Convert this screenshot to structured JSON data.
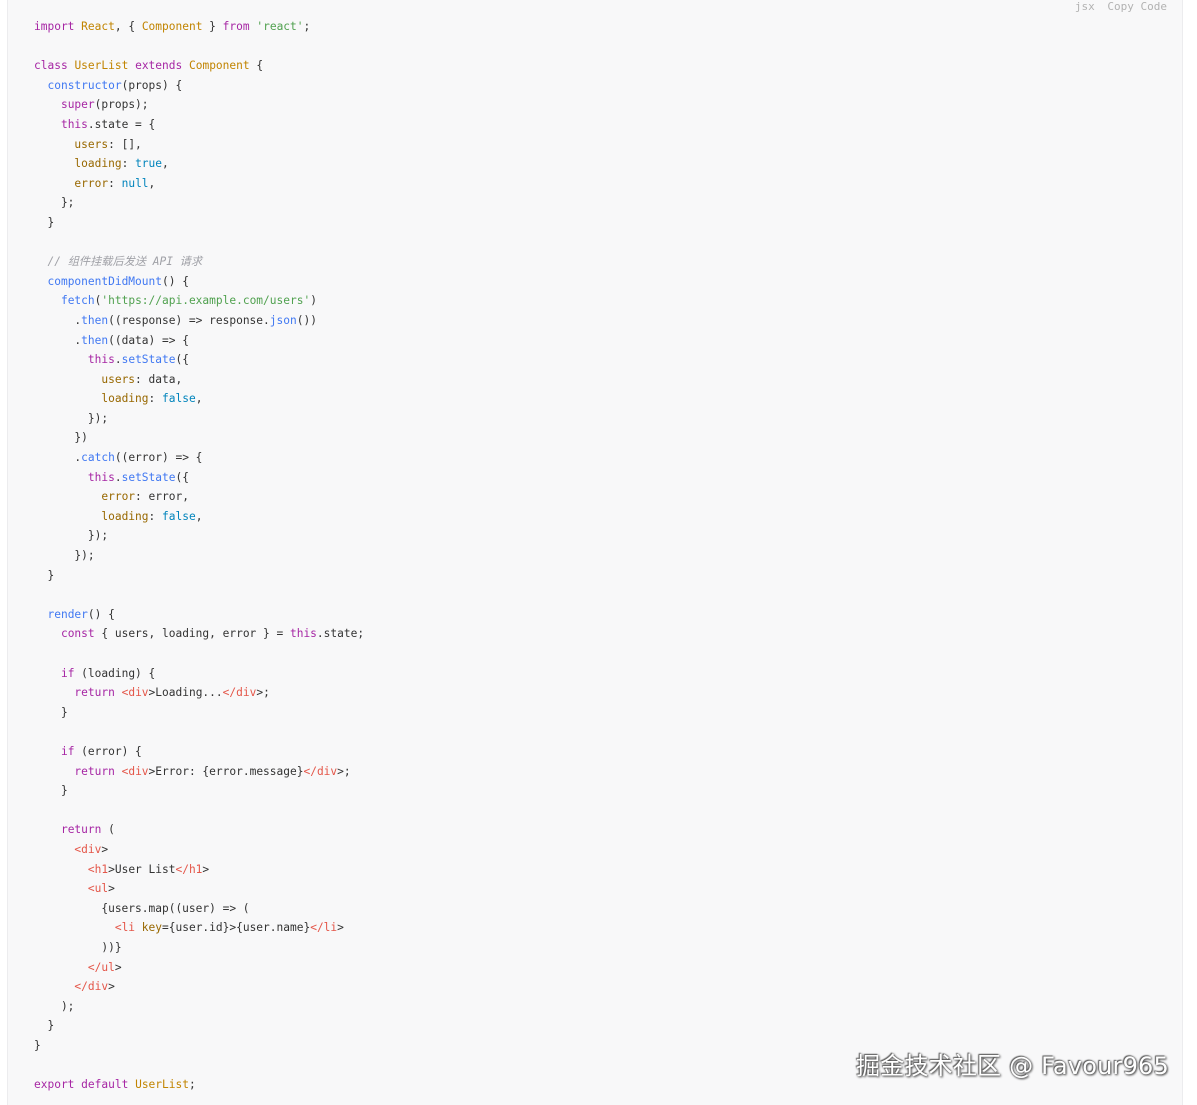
{
  "toolbar": {
    "language": "jsx",
    "copy_label": "Copy Code"
  },
  "code": {
    "lines": [
      "import React, { Component } from 'react';",
      "",
      "class UserList extends Component {",
      "  constructor(props) {",
      "    super(props);",
      "    this.state = {",
      "      users: [],",
      "      loading: true,",
      "      error: null,",
      "    };",
      "  }",
      "",
      "  // 组件挂载后发送 API 请求",
      "  componentDidMount() {",
      "    fetch('https://api.example.com/users')",
      "      .then((response) => response.json())",
      "      .then((data) => {",
      "        this.setState({",
      "          users: data,",
      "          loading: false,",
      "        });",
      "      })",
      "      .catch((error) => {",
      "        this.setState({",
      "          error: error,",
      "          loading: false,",
      "        });",
      "      });",
      "  }",
      "",
      "  render() {",
      "    const { users, loading, error } = this.state;",
      "",
      "    if (loading) {",
      "      return <div>Loading...</div>;",
      "    }",
      "",
      "    if (error) {",
      "      return <div>Error: {error.message}</div>;",
      "    }",
      "",
      "    return (",
      "      <div>",
      "        <h1>User List</h1>",
      "        <ul>",
      "          {users.map((user) => (",
      "            <li key={user.id}>{user.name}</li>",
      "          ))}",
      "        </ul>",
      "      </div>",
      "    );",
      "  }",
      "}",
      "",
      "export default UserList;"
    ]
  },
  "watermark": "掘金技术社区 @ Favour965"
}
